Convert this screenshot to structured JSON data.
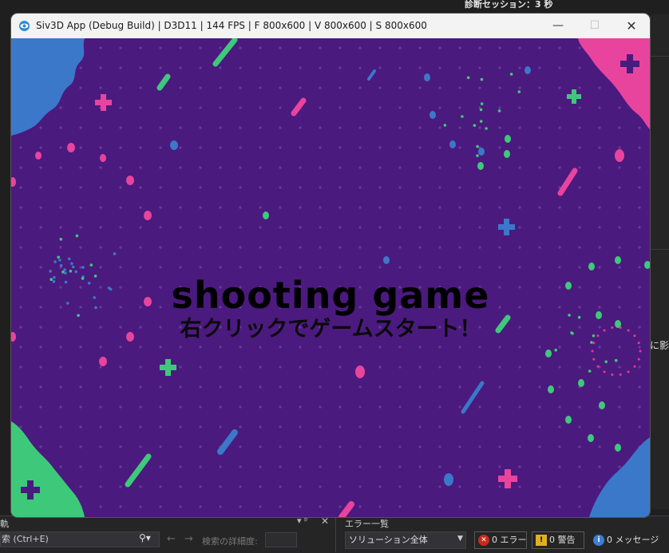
{
  "background_ide": {
    "diagnostic_session": "診断セッション：3 秒",
    "right_edge_text": "に影",
    "left_panel_title": "軌",
    "pin_glyph": "ᵖ",
    "close_glyph": "✕",
    "search_placeholder": "索 (Ctrl+E)",
    "detail_label": "検索の詳細度:",
    "error_list_title": "エラー一覧",
    "solution_scope": "ソリューション全体",
    "errors_label": "0 エラー",
    "warnings_label": "0 警告",
    "messages_label": "0 メッセージ"
  },
  "window": {
    "title": "Siv3D App (Debug Build) | D3D11 | 144 FPS | F 800x600 | V 800x600 | S 800x600",
    "minimize_glyph": "—",
    "maximize_glyph": "☐",
    "close_glyph": "✕"
  },
  "game": {
    "title": "shooting game",
    "subtitle": "右クリックでゲームスタート！"
  },
  "colors": {
    "game_background": "#4b1a7e",
    "pink": "#f0368a",
    "green": "#3ec97a",
    "blue": "#3b78c9",
    "dot_grid": "#6c3a9c"
  }
}
